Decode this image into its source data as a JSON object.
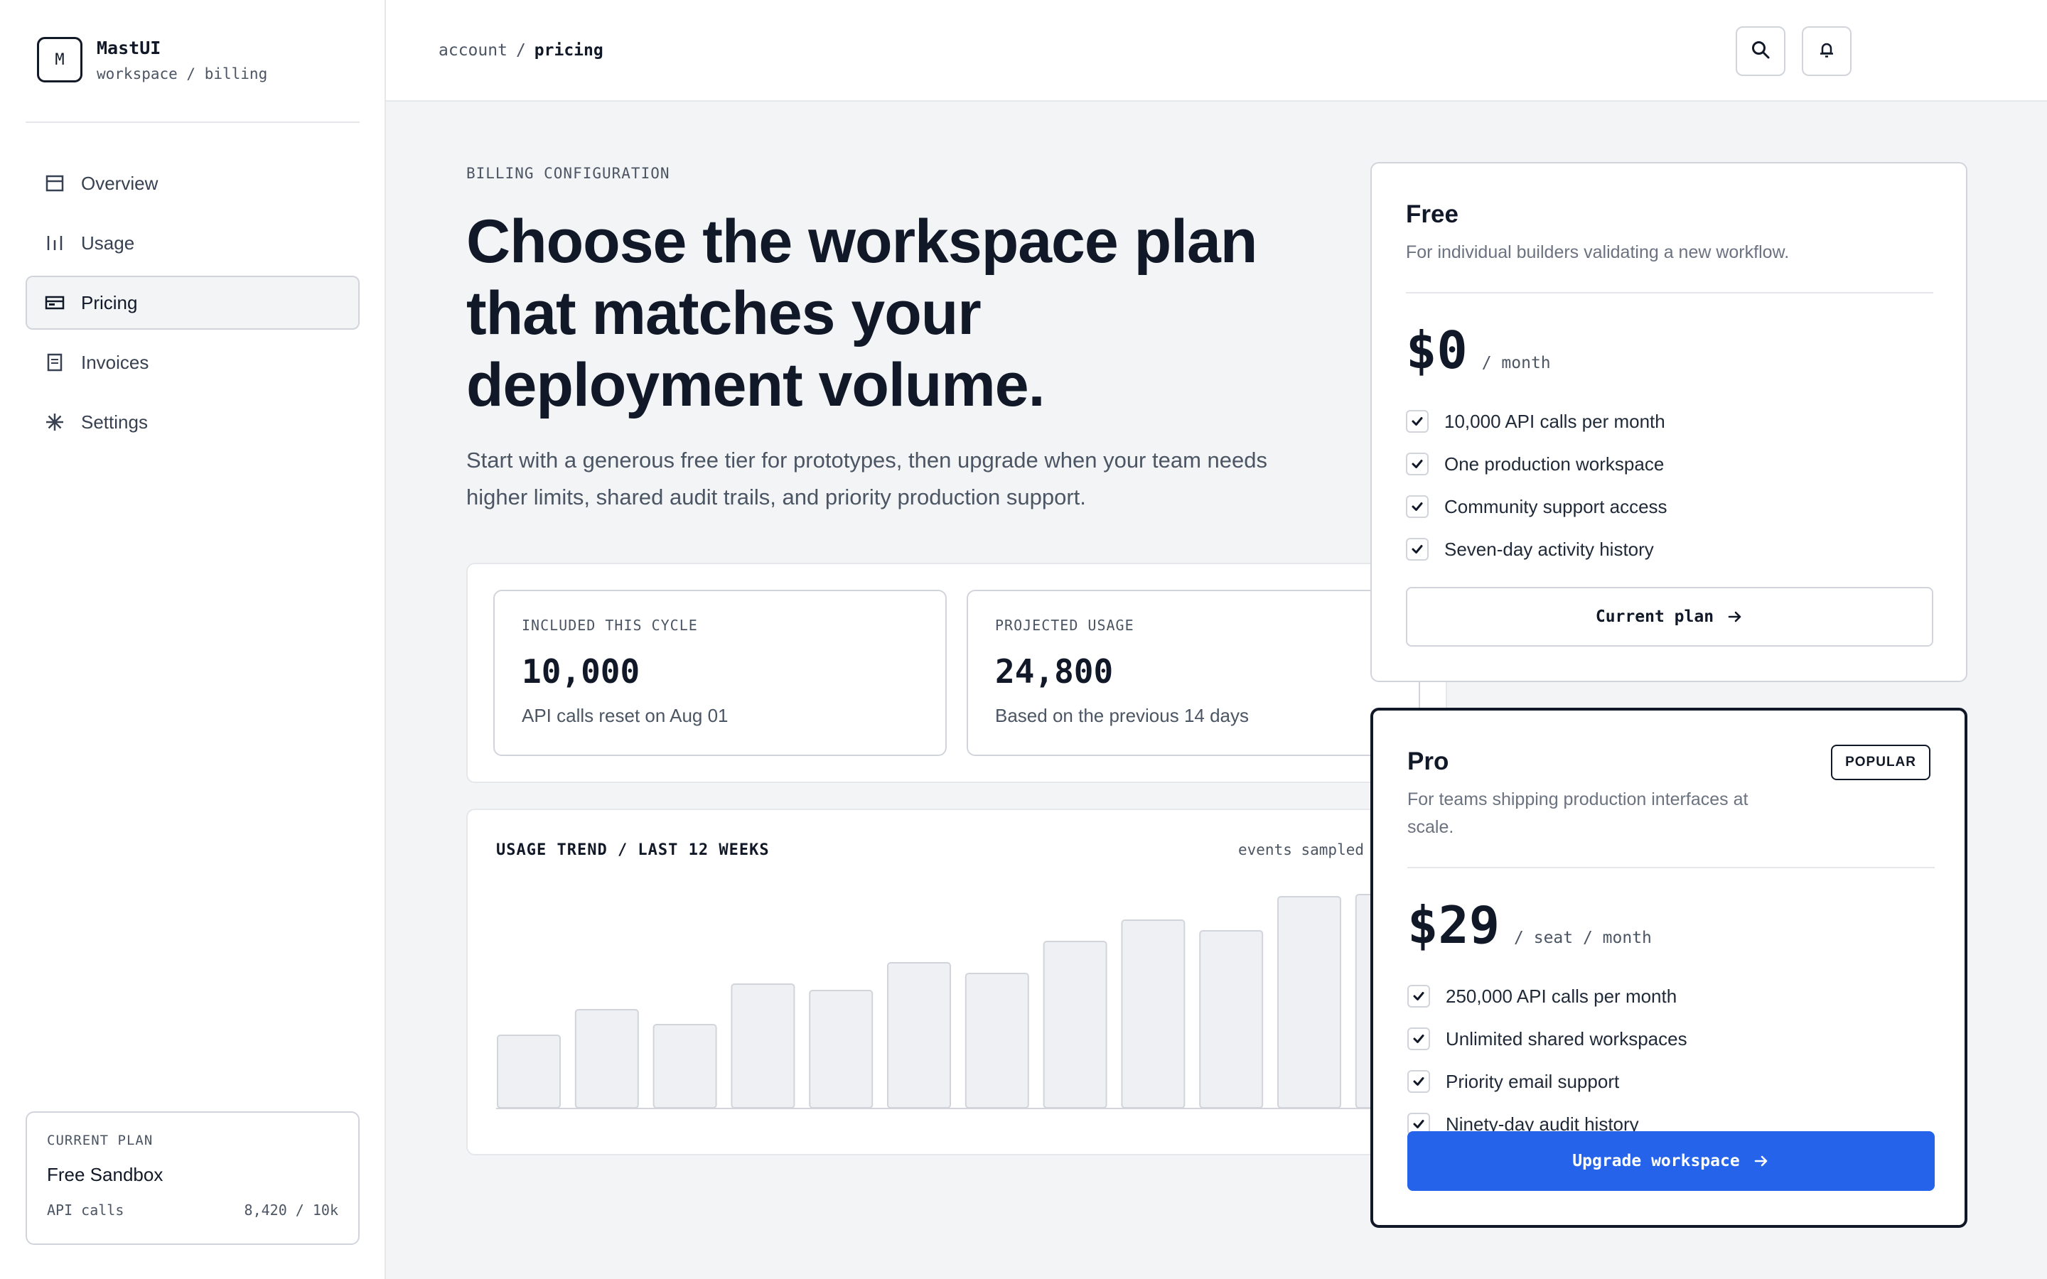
{
  "brand": {
    "mark": "M",
    "name": "MastUI",
    "sub": "workspace / billing"
  },
  "sidebar": {
    "items": [
      {
        "label": "Overview",
        "icon": "layout-icon",
        "active": false
      },
      {
        "label": "Usage",
        "icon": "bars-icon",
        "active": false
      },
      {
        "label": "Pricing",
        "icon": "card-icon",
        "active": true
      },
      {
        "label": "Invoices",
        "icon": "document-icon",
        "active": false
      },
      {
        "label": "Settings",
        "icon": "asterisk-icon",
        "active": false
      }
    ],
    "plan": {
      "kicker": "CURRENT PLAN",
      "name": "Free Sandbox",
      "metric_label": "API calls",
      "metric_value": "8,420 / 10k"
    }
  },
  "topbar": {
    "breadcrumb": [
      "account",
      "pricing"
    ],
    "separator": "/",
    "icons": [
      "search-icon",
      "bell-icon"
    ]
  },
  "hero": {
    "eyebrow": "BILLING CONFIGURATION",
    "title": "Choose the workspace plan that matches your deployment volume.",
    "subtitle": "Start with a generous free tier for prototypes, then upgrade when your team needs higher limits, shared audit trails, and priority production support."
  },
  "stats": [
    {
      "label": "INCLUDED THIS CYCLE",
      "value": "10,000",
      "note": "API calls reset on Aug 01"
    },
    {
      "label": "PROJECTED USAGE",
      "value": "24,800",
      "note": "Based on the previous 14 days"
    }
  ],
  "chart": {
    "title": "USAGE TREND / LAST 12 WEEKS",
    "note": "events sampled h",
    "bar_relative_heights": [
      0.34,
      0.46,
      0.39,
      0.58,
      0.55,
      0.68,
      0.63,
      0.78,
      0.88,
      0.83,
      0.99,
      1.0
    ],
    "bar_color": "#eff0f3",
    "bar_border": "#d1d5db"
  },
  "plans": {
    "free": {
      "name": "Free",
      "description": "For individual builders validating a new workflow.",
      "amount": "$0",
      "period": "/ month",
      "features": [
        "10,000 API calls per month",
        "One production workspace",
        "Community support access",
        "Seven-day activity history"
      ],
      "button": "Current plan"
    },
    "pro": {
      "name": "Pro",
      "badge": "POPULAR",
      "description": "For teams shipping production interfaces at scale.",
      "amount": "$29",
      "period": "/ seat / month",
      "features": [
        "250,000 API calls per month",
        "Unlimited shared workspaces",
        "Priority email support",
        "Ninety-day audit history"
      ],
      "button": "Upgrade workspace"
    }
  },
  "colors": {
    "accent": "#2563eb",
    "text": "#111827",
    "muted": "#4b5563",
    "background": "#f3f4f6"
  }
}
